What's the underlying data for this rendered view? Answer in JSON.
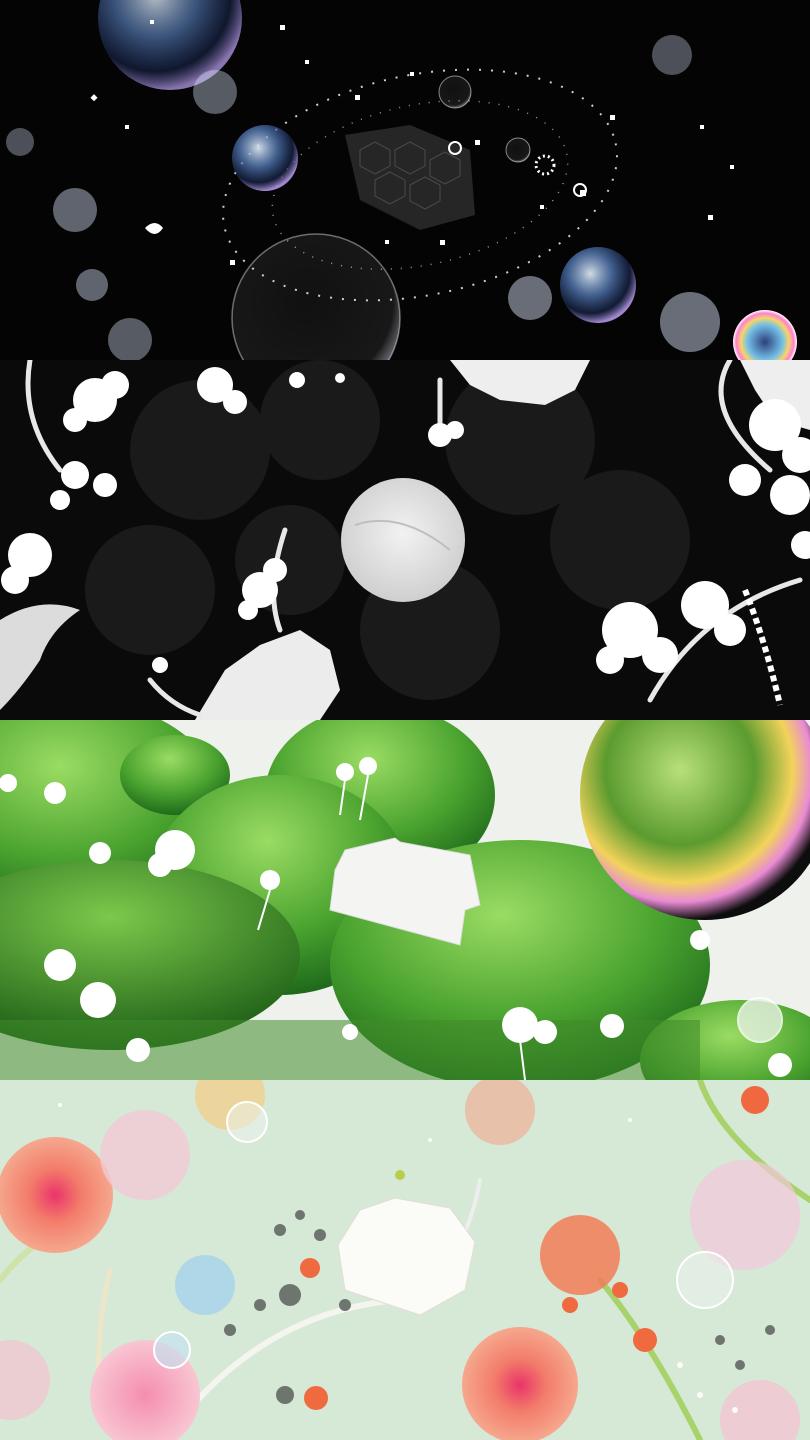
{
  "panels": [
    {
      "scene": "black-space-bubbles",
      "background": "#040404"
    },
    {
      "scene": "black-white-flowers",
      "background": "#0a0a0a"
    },
    {
      "scene": "green-moss-hills",
      "background": "#eef1ec"
    },
    {
      "scene": "pastel-coral-flowers",
      "background": "#dbe9dc"
    }
  ],
  "colors": {
    "accent_green": "#3f9a2c",
    "moss_light": "#8dd15a",
    "coral": "#f0775d",
    "pink": "#f3b6c4",
    "pastel_bg": "#d6e8d6"
  }
}
